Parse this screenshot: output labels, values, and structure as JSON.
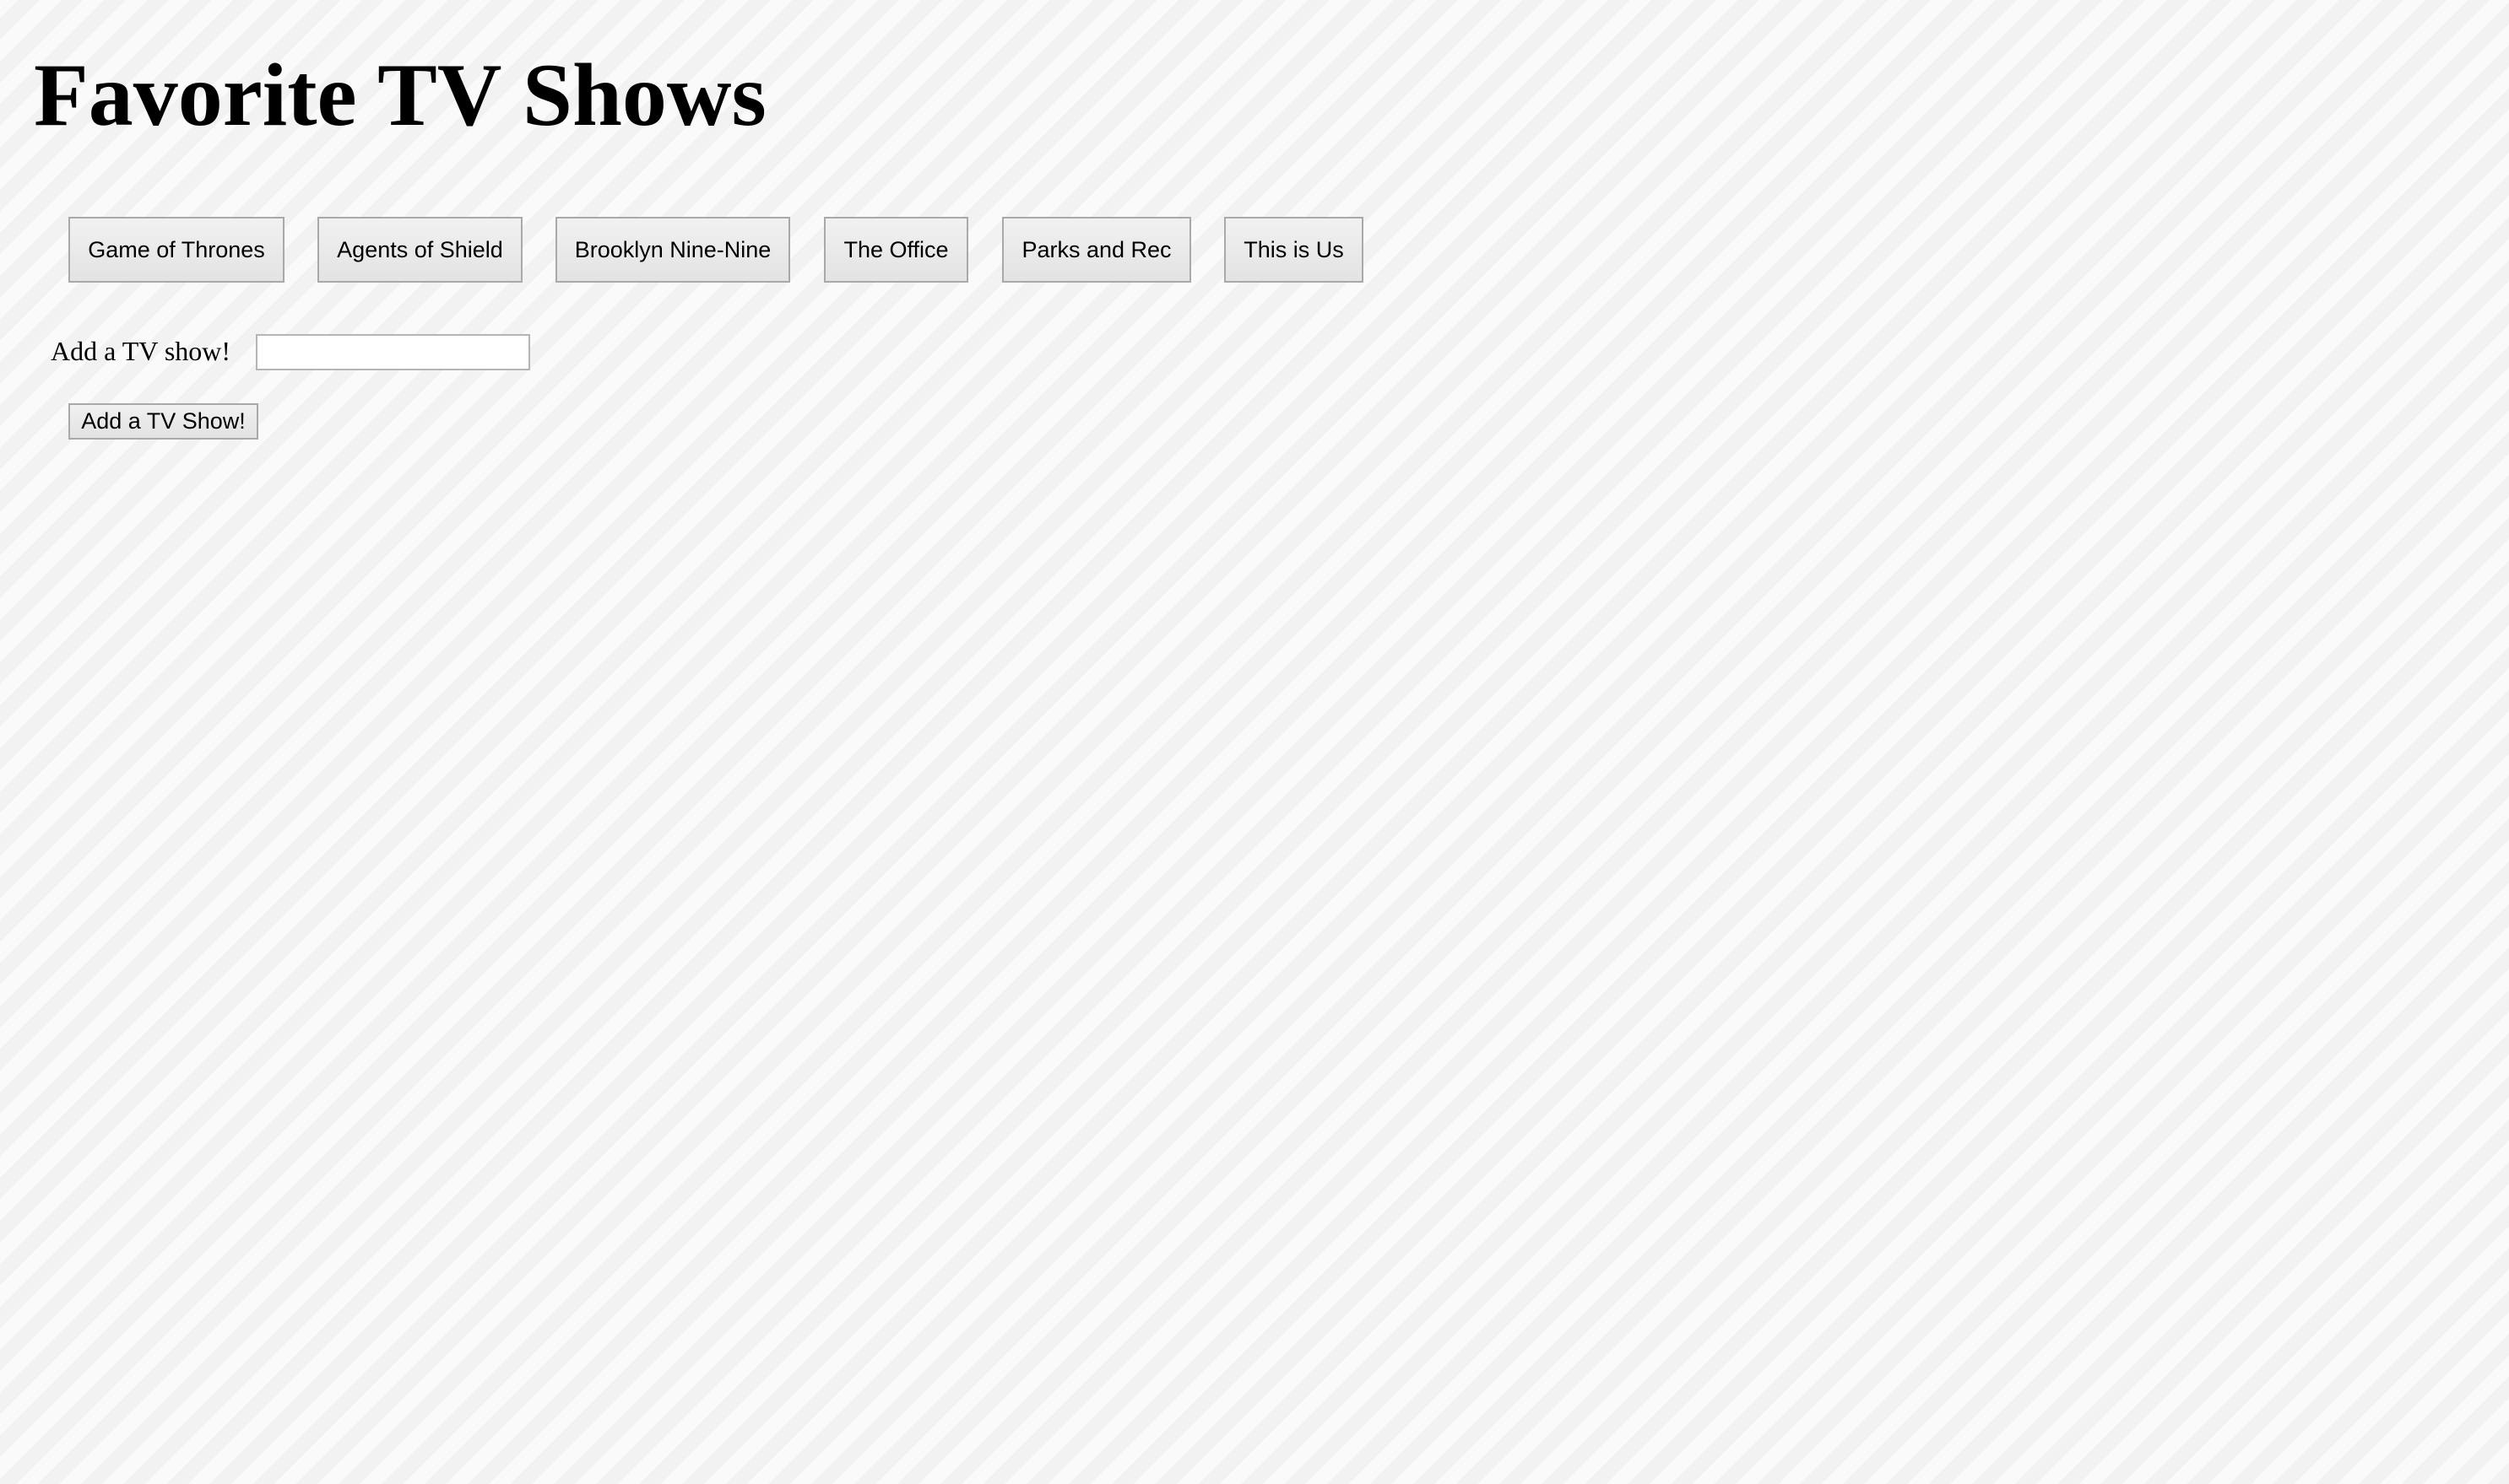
{
  "page": {
    "title": "Favorite TV Shows"
  },
  "shows": [
    {
      "label": "Game of Thrones"
    },
    {
      "label": "Agents of Shield"
    },
    {
      "label": "Brooklyn Nine-Nine"
    },
    {
      "label": "The Office"
    },
    {
      "label": "Parks and Rec"
    },
    {
      "label": "This is Us"
    }
  ],
  "form": {
    "label": "Add a TV show!",
    "input_value": "",
    "submit_label": "Add a TV Show!"
  }
}
